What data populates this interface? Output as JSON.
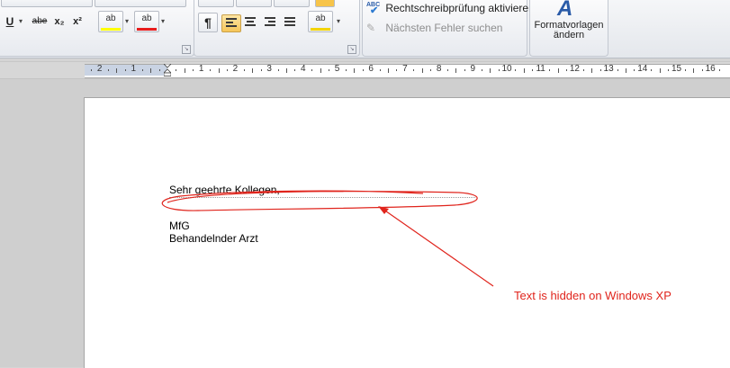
{
  "toolbar": {
    "font_buttons": [
      {
        "name": "underline",
        "glyph": "U"
      },
      {
        "name": "strikethrough",
        "glyph": "abe"
      },
      {
        "name": "subscript",
        "glyph": "x₂"
      },
      {
        "name": "superscript",
        "glyph": "x²"
      }
    ],
    "highlight_color": "#ffff00",
    "font_color": "#e81c1c",
    "paragraph_mark_glyph": "¶",
    "style_color_label": "ab",
    "highlight_label": "ab",
    "font_color_label": "ab",
    "dropdown_glyph": "▾",
    "launcher_glyph": "↘"
  },
  "proofing": {
    "spellcheck_label": "Rechtschreibprüfung aktivieren",
    "spellcheck_icon_text": "ABC",
    "next_error_label": "Nächsten Fehler suchen"
  },
  "styles": {
    "label_line1": "Formatvorlagen",
    "label_line2": "ändern"
  },
  "ruler": {
    "labels": [
      "2",
      "1",
      "1",
      "2",
      "3",
      "4",
      "5",
      "6",
      "7",
      "8",
      "9",
      "10",
      "11",
      "12",
      "13",
      "14",
      "15",
      "16"
    ]
  },
  "document": {
    "lines": [
      "Sehr geehrte Kollegen,",
      "MfG",
      "Behandelnder Arzt"
    ]
  },
  "annotation": {
    "text": "Text is hidden on Windows XP",
    "color": "#e0241c"
  }
}
